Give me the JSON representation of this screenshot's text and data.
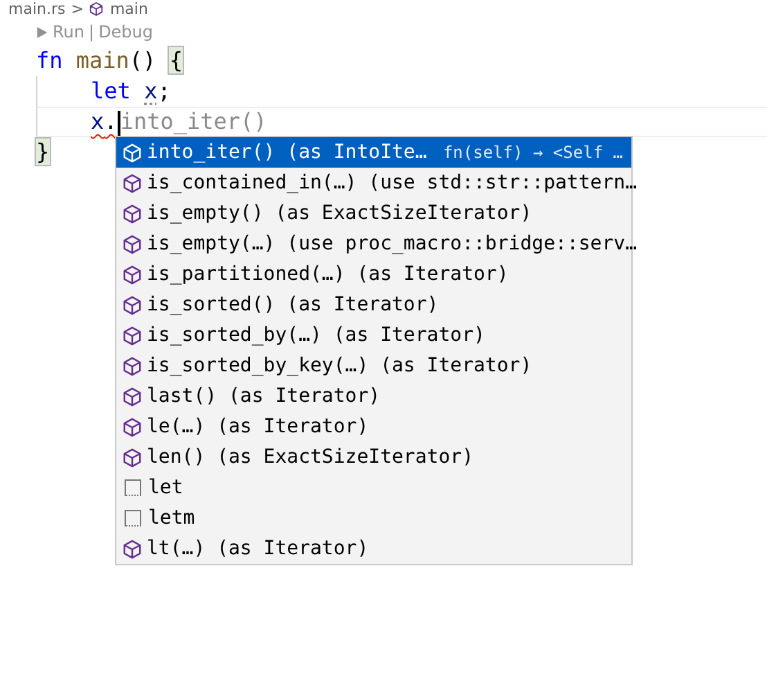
{
  "breadcrumb": {
    "file": "main.rs",
    "separator": ">",
    "symbol": "main"
  },
  "codelens": {
    "run": "Run",
    "separator": "|",
    "debug": "Debug"
  },
  "code_lines": [
    {
      "current": false,
      "tokens": [
        {
          "kind": "keyword",
          "text": "fn"
        },
        {
          "kind": "function",
          "text": "main"
        },
        {
          "kind": "punct",
          "text": "()"
        },
        {
          "kind": "brace",
          "text": "{",
          "matched": true
        }
      ],
      "children": [
        {
          "current": false,
          "tokens": [
            {
              "kind": "keyword",
              "text": "let"
            },
            {
              "kind": "variable",
              "text": "x",
              "hint": true
            },
            {
              "kind": "punct",
              "text": ";"
            }
          ]
        },
        {
          "current": true,
          "tokens": [
            {
              "kind": "variable",
              "text": "x",
              "error": true
            },
            {
              "kind": "punct",
              "text": ".",
              "error": true
            },
            {
              "kind": "cursor"
            },
            {
              "kind": "ghost",
              "text": "into_iter()"
            }
          ]
        }
      ]
    },
    {
      "current": false,
      "tokens": [
        {
          "kind": "brace",
          "text": "}",
          "matched": true
        }
      ]
    }
  ],
  "completions": [
    {
      "kind": "method",
      "label": "into_iter() (as IntoIte…",
      "detail": "fn(self) → <Self …",
      "selected": true
    },
    {
      "kind": "method",
      "label": "is_contained_in(…) (use std::str::pattern…",
      "selected": false
    },
    {
      "kind": "method",
      "label": "is_empty() (as ExactSizeIterator)",
      "selected": false
    },
    {
      "kind": "method",
      "label": "is_empty(…) (use proc_macro::bridge::serv…",
      "selected": false
    },
    {
      "kind": "method",
      "label": "is_partitioned(…) (as Iterator)",
      "selected": false
    },
    {
      "kind": "method",
      "label": "is_sorted() (as Iterator)",
      "selected": false
    },
    {
      "kind": "method",
      "label": "is_sorted_by(…) (as Iterator)",
      "selected": false
    },
    {
      "kind": "method",
      "label": "is_sorted_by_key(…) (as Iterator)",
      "selected": false
    },
    {
      "kind": "method",
      "label": "last() (as Iterator)",
      "selected": false
    },
    {
      "kind": "method",
      "label": "le(…) (as Iterator)",
      "selected": false
    },
    {
      "kind": "method",
      "label": "len() (as ExactSizeIterator)",
      "selected": false
    },
    {
      "kind": "snippet",
      "label": "let",
      "selected": false
    },
    {
      "kind": "snippet",
      "label": "letm",
      "selected": false
    },
    {
      "kind": "method",
      "label": "lt(…) (as Iterator)",
      "selected": false
    }
  ]
}
